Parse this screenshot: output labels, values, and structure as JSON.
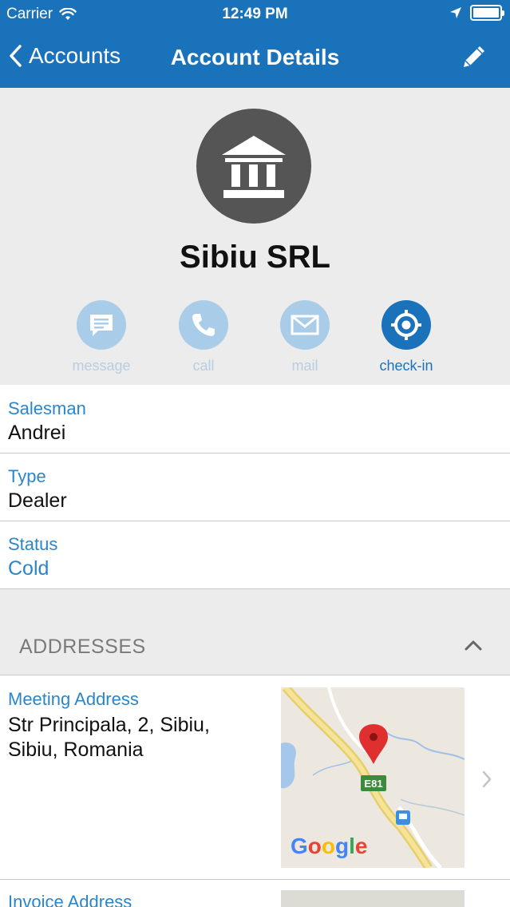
{
  "status_bar": {
    "carrier": "Carrier",
    "time": "12:49 PM"
  },
  "nav": {
    "back_label": "Accounts",
    "title": "Account Details",
    "edit_icon": "pencil-icon"
  },
  "account": {
    "name": "Sibiu SRL",
    "avatar_icon": "bank-building-icon"
  },
  "actions": [
    {
      "label": "message",
      "icon": "message-icon",
      "enabled": false
    },
    {
      "label": "call",
      "icon": "phone-icon",
      "enabled": false
    },
    {
      "label": "mail",
      "icon": "mail-icon",
      "enabled": false
    },
    {
      "label": "check-in",
      "icon": "target-icon",
      "enabled": true
    }
  ],
  "fields": [
    {
      "label": "Salesman",
      "value": "Andrei"
    },
    {
      "label": "Type",
      "value": "Dealer"
    },
    {
      "label": "Status",
      "value": "Cold"
    }
  ],
  "addresses_section": {
    "title": "ADDRESSES",
    "items": [
      {
        "label": "Meeting Address",
        "value": "Str Principala, 2, Sibiu, Sibiu, Romania",
        "map_road_label": "E81",
        "map_brand": "Google"
      },
      {
        "label": "Invoice Address"
      }
    ]
  },
  "colors": {
    "accent": "#1a72bb",
    "label_blue": "#2a86c9",
    "header_gray": "#ececec",
    "avatar_gray": "#565556",
    "disabled_action": "#a9cde8"
  }
}
